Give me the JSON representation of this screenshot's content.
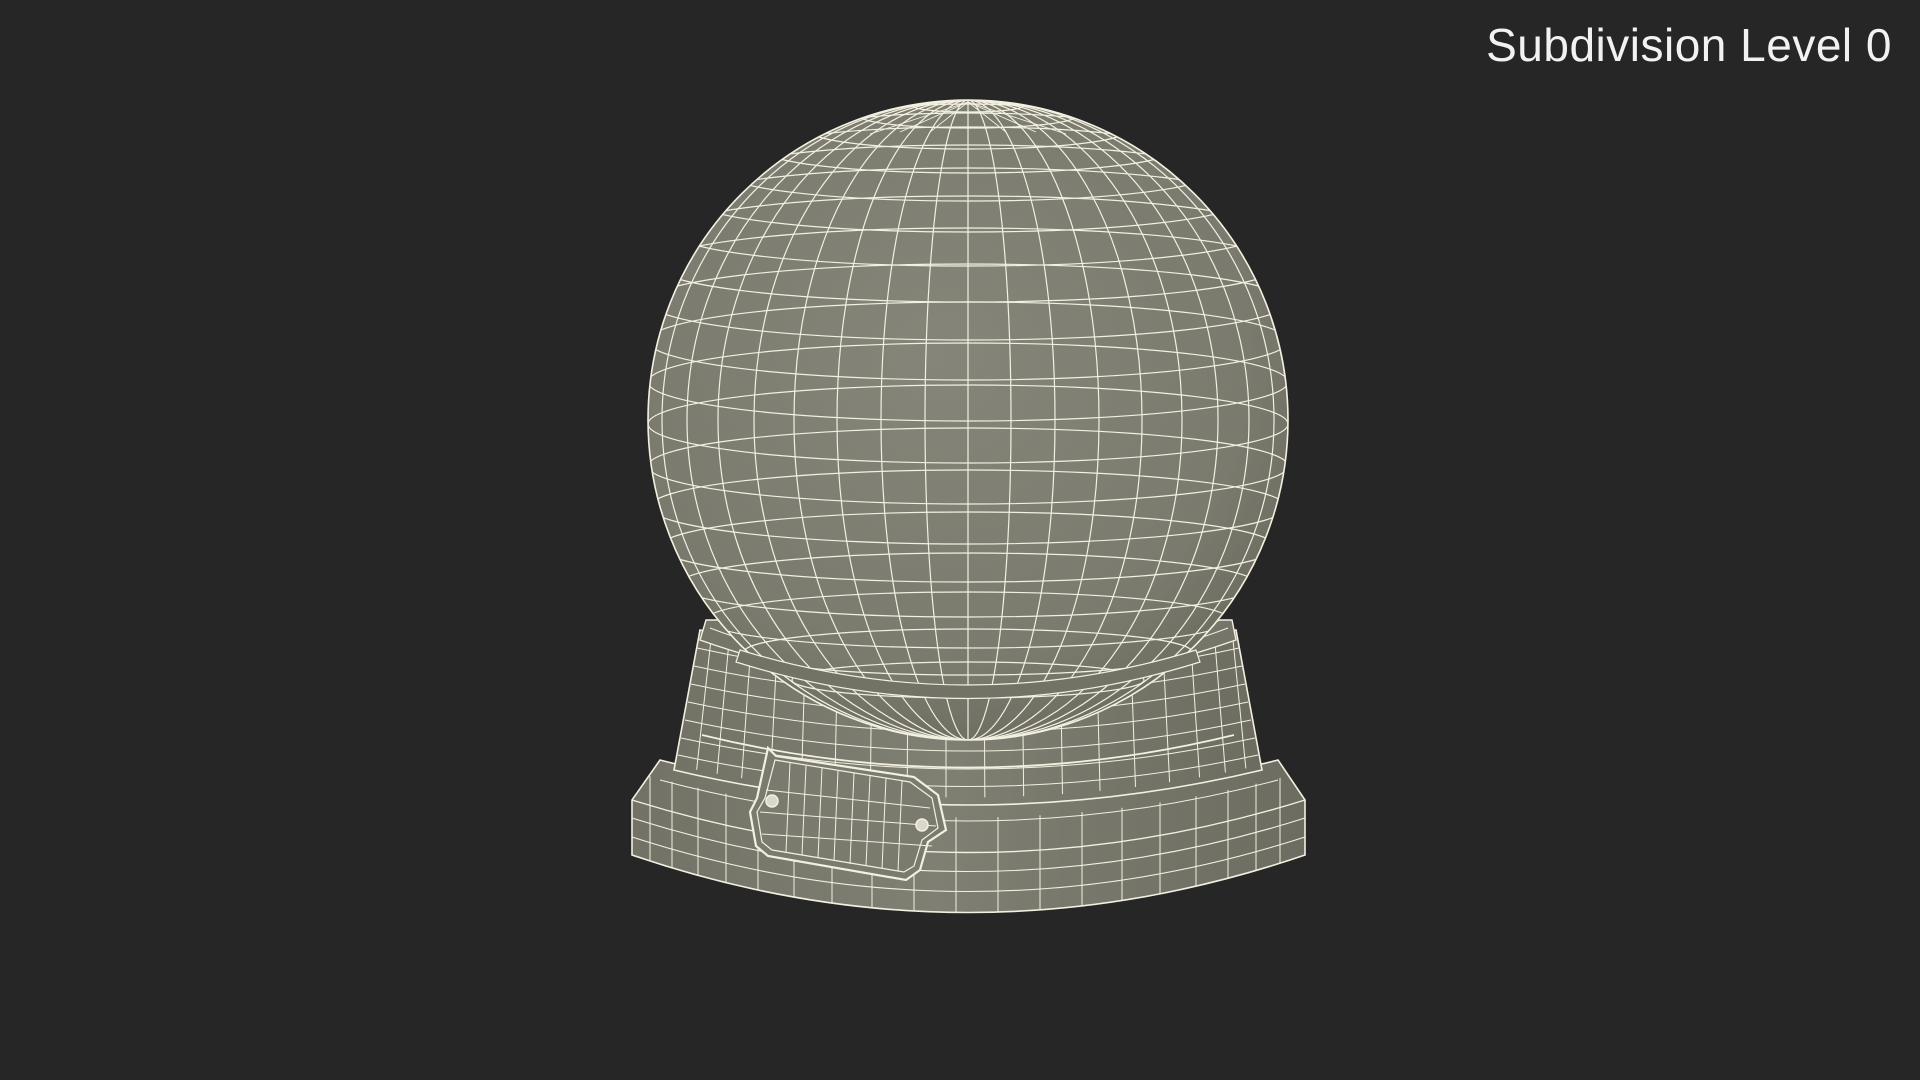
{
  "viewport": {
    "subdivision_label": "Subdivision Level 0",
    "background_color": "#262626",
    "mesh_fill_color": "#7b7b6f",
    "wire_color": "#f3f0e0"
  },
  "model": {
    "object": "snow globe wireframe"
  }
}
